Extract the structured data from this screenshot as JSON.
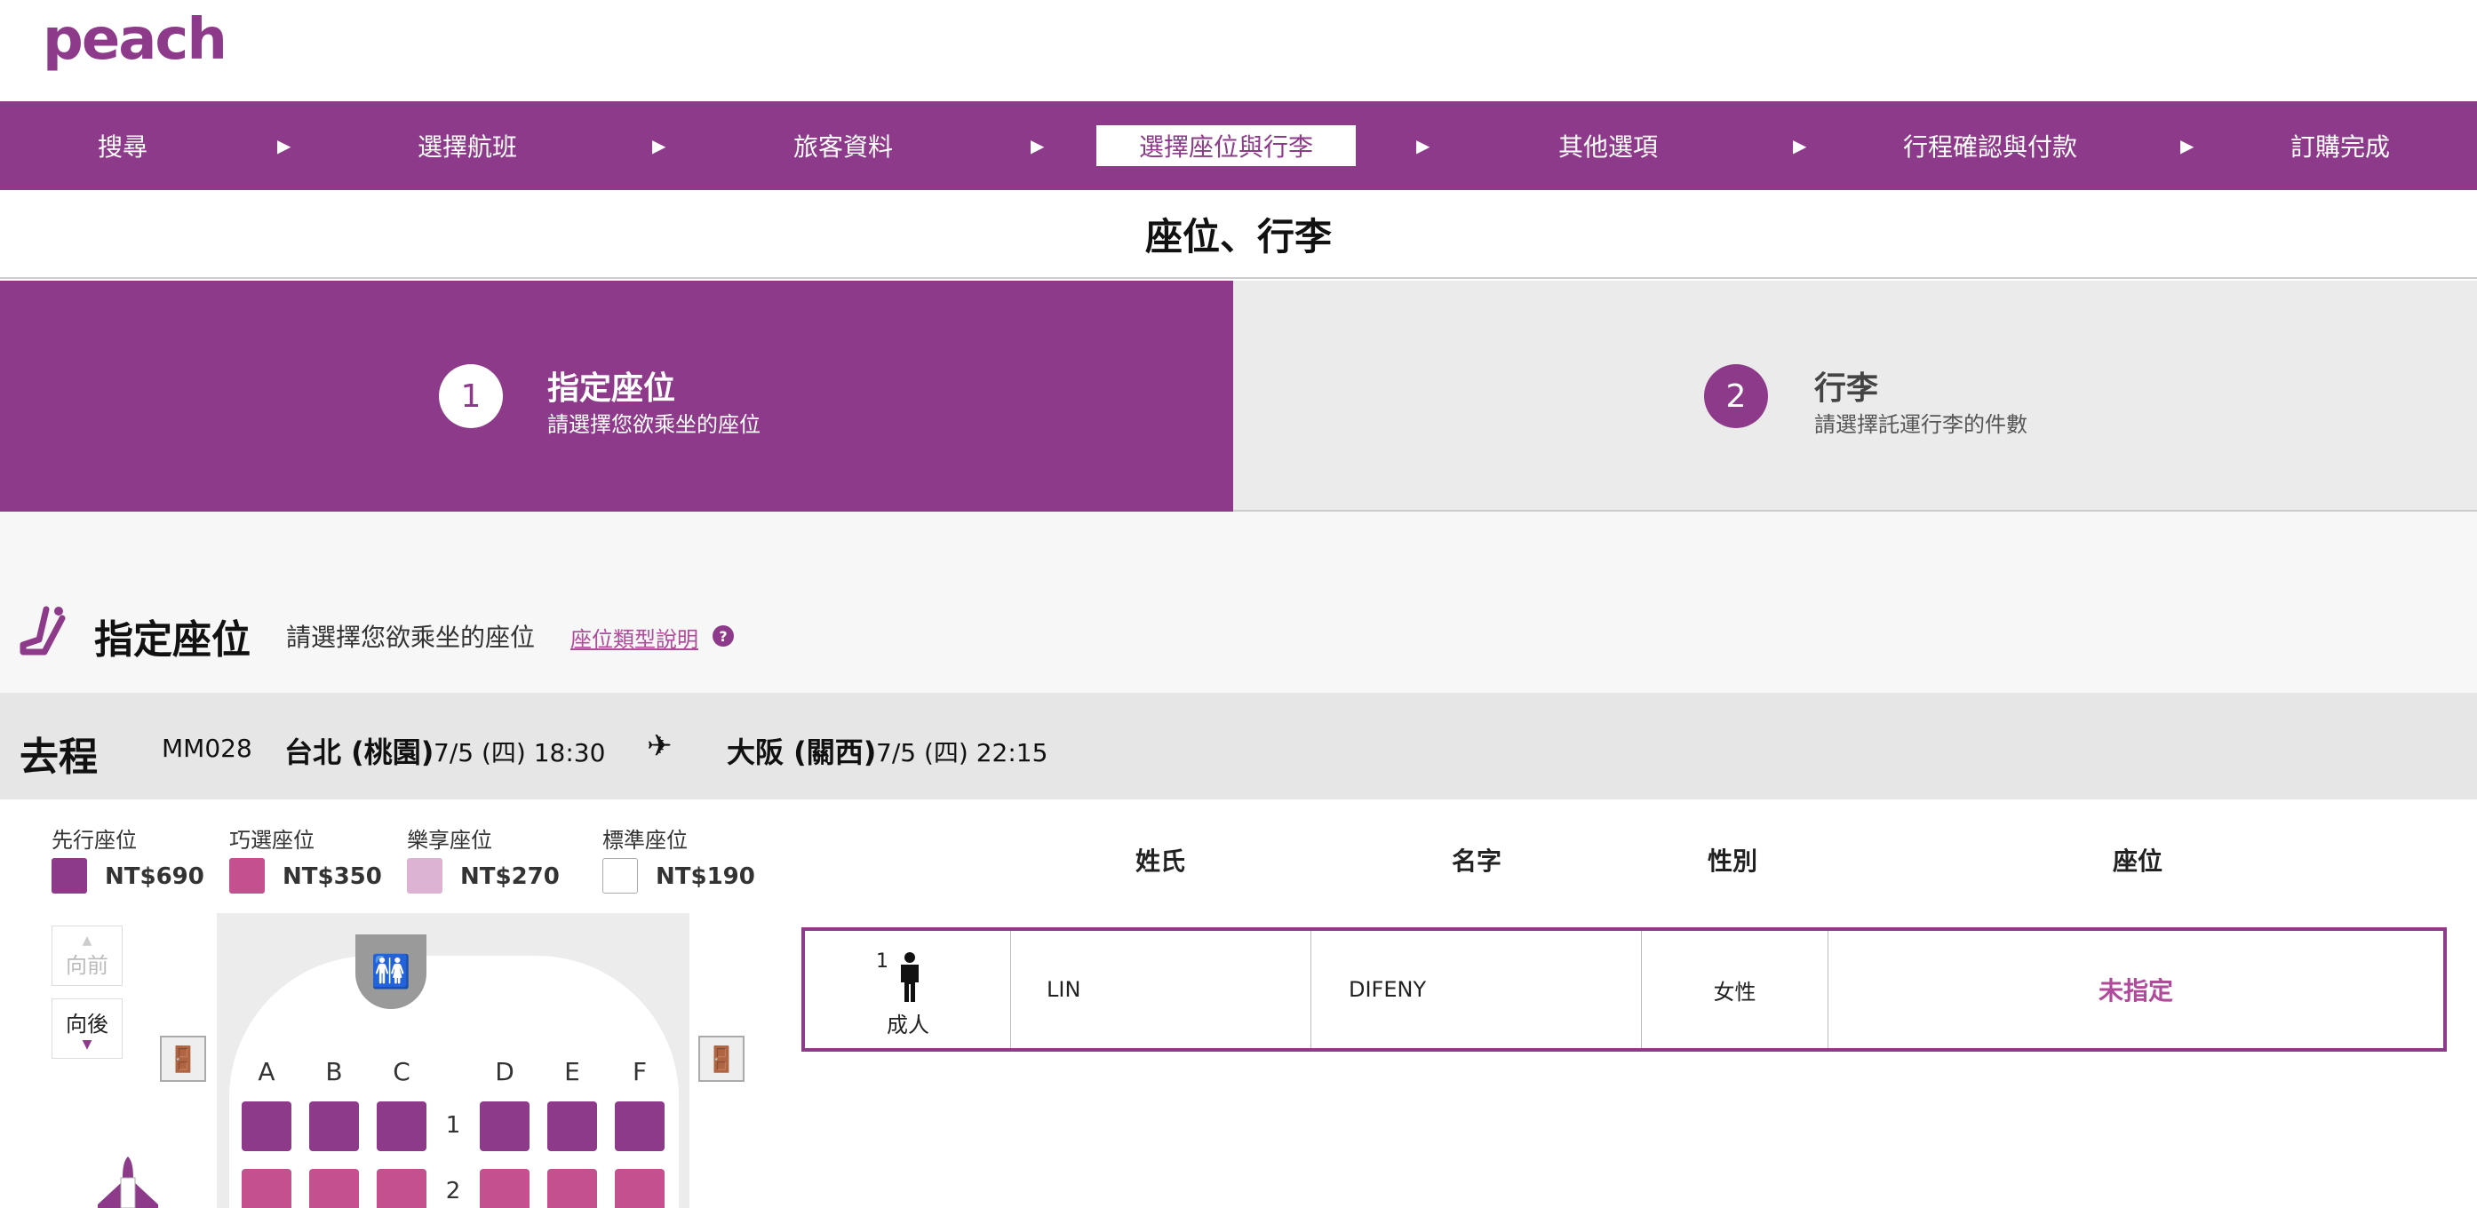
{
  "brand": {
    "logo_text": "peach",
    "accent": "#8e3a8a",
    "pink": "#b04a9a"
  },
  "steps": [
    {
      "label": "搜尋"
    },
    {
      "label": "選擇航班"
    },
    {
      "label": "旅客資料"
    },
    {
      "label": "選擇座位與行李",
      "active": true
    },
    {
      "label": "其他選項"
    },
    {
      "label": "行程確認與付款"
    },
    {
      "label": "訂購完成"
    }
  ],
  "page_title": "座位、行李",
  "tabs": [
    {
      "num": "1",
      "title": "指定座位",
      "sub": "請選擇您欲乘坐的座位",
      "active": true
    },
    {
      "num": "2",
      "title": "行李",
      "sub": "請選擇託運行李的件數",
      "active": false
    }
  ],
  "section": {
    "title": "指定座位",
    "subtitle": "請選擇您欲乘坐的座位",
    "link": "座位類型說明",
    "help": "?"
  },
  "flight": {
    "direction": "去程",
    "number": "MM028",
    "from": "台北 (桃園)",
    "from_time": "7/5 (四) 18:30",
    "plane_glyph": "✈",
    "to": "大阪 (關西)",
    "to_time": "7/5 (四) 22:15"
  },
  "legend": [
    {
      "name": "先行座位",
      "price": "NT$690",
      "color": "#8e3a8a"
    },
    {
      "name": "巧選座位",
      "price": "NT$350",
      "color": "#c4508f"
    },
    {
      "name": "樂享座位",
      "price": "NT$270",
      "color": "#dcb3d3"
    },
    {
      "name": "標準座位",
      "price": "NT$190",
      "color": "#ffffff"
    }
  ],
  "seatmap": {
    "btn_forward": "向前",
    "btn_backward": "向後",
    "columns": [
      "A",
      "B",
      "C",
      "D",
      "E",
      "F"
    ],
    "rows": [
      "1",
      "2"
    ],
    "row_colors": [
      "#8e3a8a",
      "#c4508f"
    ]
  },
  "passenger_table": {
    "headers": {
      "surname": "姓氏",
      "given": "名字",
      "gender": "性別",
      "seat": "座位"
    },
    "rows": [
      {
        "num": "1",
        "type": "成人",
        "surname": "LIN",
        "given": "DIFENY",
        "gender": "女性",
        "seat": "未指定"
      }
    ]
  }
}
